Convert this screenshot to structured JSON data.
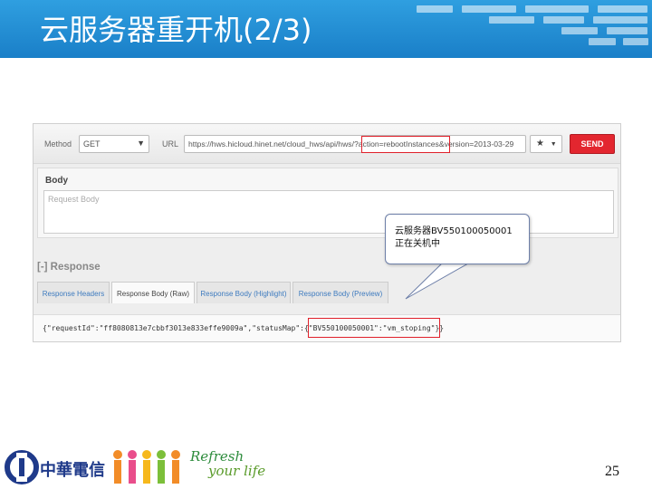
{
  "slide": {
    "title": "云服务器重开机(2/3)",
    "page_number": "25",
    "brand_name": "中華電信",
    "slogan_line1": "Refresh",
    "slogan_line2": "your life"
  },
  "request": {
    "method_label": "Method",
    "method_value": "GET",
    "url_label": "URL",
    "url_value": "https://hws.hicloud.hinet.net/cloud_hws/api/hws/?action=rebootInstances&version=2013-03-29",
    "send_label": "SEND",
    "body_title": "Body",
    "body_placeholder": "Request Body"
  },
  "response": {
    "title": "[-] Response",
    "tabs": [
      "Response Headers",
      "Response Body (Raw)",
      "Response Body (Highlight)",
      "Response Body (Preview)"
    ],
    "active_tab": "Response Body (Raw)",
    "raw_body": "{\"requestId\":\"ff8080813e7cbbf3013e833effe9009a\",\"statusMap\":{\"BV550100050001\":\"vm_stoping\"}}"
  },
  "callout": {
    "line1": "云服务器BV550100050001",
    "line2": "正在关机中"
  },
  "colors": {
    "banner": "#1a7fc8",
    "send_button": "#e3262f",
    "highlight": "#e0202a"
  }
}
